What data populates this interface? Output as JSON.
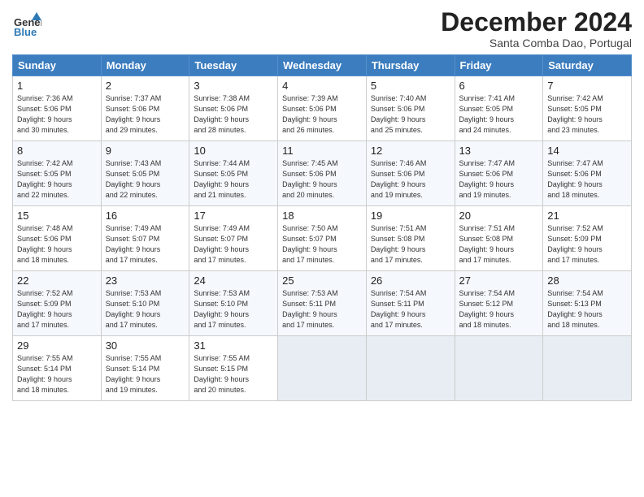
{
  "header": {
    "logo_general": "General",
    "logo_blue": "Blue",
    "month_title": "December 2024",
    "location": "Santa Comba Dao, Portugal"
  },
  "days_of_week": [
    "Sunday",
    "Monday",
    "Tuesday",
    "Wednesday",
    "Thursday",
    "Friday",
    "Saturday"
  ],
  "weeks": [
    [
      {
        "day": "1",
        "info": "Sunrise: 7:36 AM\nSunset: 5:06 PM\nDaylight: 9 hours\nand 30 minutes."
      },
      {
        "day": "2",
        "info": "Sunrise: 7:37 AM\nSunset: 5:06 PM\nDaylight: 9 hours\nand 29 minutes."
      },
      {
        "day": "3",
        "info": "Sunrise: 7:38 AM\nSunset: 5:06 PM\nDaylight: 9 hours\nand 28 minutes."
      },
      {
        "day": "4",
        "info": "Sunrise: 7:39 AM\nSunset: 5:06 PM\nDaylight: 9 hours\nand 26 minutes."
      },
      {
        "day": "5",
        "info": "Sunrise: 7:40 AM\nSunset: 5:06 PM\nDaylight: 9 hours\nand 25 minutes."
      },
      {
        "day": "6",
        "info": "Sunrise: 7:41 AM\nSunset: 5:05 PM\nDaylight: 9 hours\nand 24 minutes."
      },
      {
        "day": "7",
        "info": "Sunrise: 7:42 AM\nSunset: 5:05 PM\nDaylight: 9 hours\nand 23 minutes."
      }
    ],
    [
      {
        "day": "8",
        "info": "Sunrise: 7:42 AM\nSunset: 5:05 PM\nDaylight: 9 hours\nand 22 minutes."
      },
      {
        "day": "9",
        "info": "Sunrise: 7:43 AM\nSunset: 5:05 PM\nDaylight: 9 hours\nand 22 minutes."
      },
      {
        "day": "10",
        "info": "Sunrise: 7:44 AM\nSunset: 5:05 PM\nDaylight: 9 hours\nand 21 minutes."
      },
      {
        "day": "11",
        "info": "Sunrise: 7:45 AM\nSunset: 5:06 PM\nDaylight: 9 hours\nand 20 minutes."
      },
      {
        "day": "12",
        "info": "Sunrise: 7:46 AM\nSunset: 5:06 PM\nDaylight: 9 hours\nand 19 minutes."
      },
      {
        "day": "13",
        "info": "Sunrise: 7:47 AM\nSunset: 5:06 PM\nDaylight: 9 hours\nand 19 minutes."
      },
      {
        "day": "14",
        "info": "Sunrise: 7:47 AM\nSunset: 5:06 PM\nDaylight: 9 hours\nand 18 minutes."
      }
    ],
    [
      {
        "day": "15",
        "info": "Sunrise: 7:48 AM\nSunset: 5:06 PM\nDaylight: 9 hours\nand 18 minutes."
      },
      {
        "day": "16",
        "info": "Sunrise: 7:49 AM\nSunset: 5:07 PM\nDaylight: 9 hours\nand 17 minutes."
      },
      {
        "day": "17",
        "info": "Sunrise: 7:49 AM\nSunset: 5:07 PM\nDaylight: 9 hours\nand 17 minutes."
      },
      {
        "day": "18",
        "info": "Sunrise: 7:50 AM\nSunset: 5:07 PM\nDaylight: 9 hours\nand 17 minutes."
      },
      {
        "day": "19",
        "info": "Sunrise: 7:51 AM\nSunset: 5:08 PM\nDaylight: 9 hours\nand 17 minutes."
      },
      {
        "day": "20",
        "info": "Sunrise: 7:51 AM\nSunset: 5:08 PM\nDaylight: 9 hours\nand 17 minutes."
      },
      {
        "day": "21",
        "info": "Sunrise: 7:52 AM\nSunset: 5:09 PM\nDaylight: 9 hours\nand 17 minutes."
      }
    ],
    [
      {
        "day": "22",
        "info": "Sunrise: 7:52 AM\nSunset: 5:09 PM\nDaylight: 9 hours\nand 17 minutes."
      },
      {
        "day": "23",
        "info": "Sunrise: 7:53 AM\nSunset: 5:10 PM\nDaylight: 9 hours\nand 17 minutes."
      },
      {
        "day": "24",
        "info": "Sunrise: 7:53 AM\nSunset: 5:10 PM\nDaylight: 9 hours\nand 17 minutes."
      },
      {
        "day": "25",
        "info": "Sunrise: 7:53 AM\nSunset: 5:11 PM\nDaylight: 9 hours\nand 17 minutes."
      },
      {
        "day": "26",
        "info": "Sunrise: 7:54 AM\nSunset: 5:11 PM\nDaylight: 9 hours\nand 17 minutes."
      },
      {
        "day": "27",
        "info": "Sunrise: 7:54 AM\nSunset: 5:12 PM\nDaylight: 9 hours\nand 18 minutes."
      },
      {
        "day": "28",
        "info": "Sunrise: 7:54 AM\nSunset: 5:13 PM\nDaylight: 9 hours\nand 18 minutes."
      }
    ],
    [
      {
        "day": "29",
        "info": "Sunrise: 7:55 AM\nSunset: 5:14 PM\nDaylight: 9 hours\nand 18 minutes."
      },
      {
        "day": "30",
        "info": "Sunrise: 7:55 AM\nSunset: 5:14 PM\nDaylight: 9 hours\nand 19 minutes."
      },
      {
        "day": "31",
        "info": "Sunrise: 7:55 AM\nSunset: 5:15 PM\nDaylight: 9 hours\nand 20 minutes."
      },
      {
        "day": "",
        "info": ""
      },
      {
        "day": "",
        "info": ""
      },
      {
        "day": "",
        "info": ""
      },
      {
        "day": "",
        "info": ""
      }
    ]
  ]
}
